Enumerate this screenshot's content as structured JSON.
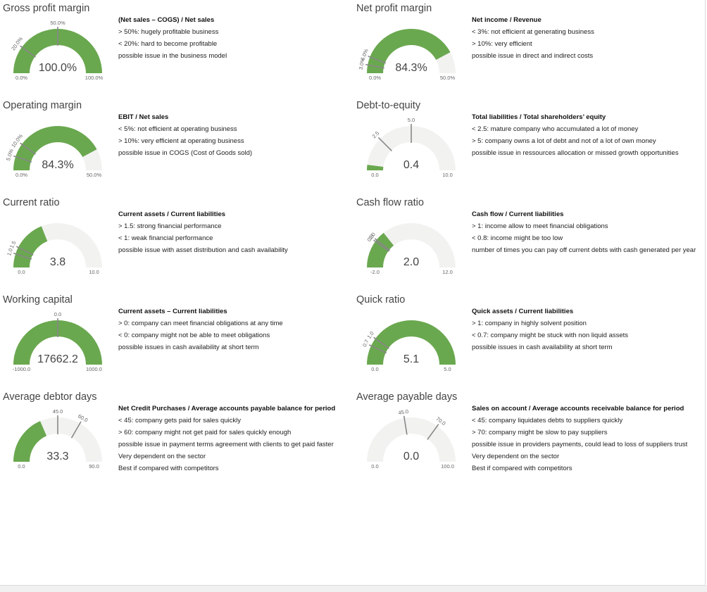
{
  "colors": {
    "track": "#f2f2f0",
    "fill": "#6aa84f",
    "marker": "#888888",
    "text": "#444444"
  },
  "chart_data": [
    {
      "type": "gauge",
      "title": "Gross profit margin",
      "min": 0.0,
      "max": 100.0,
      "value": 100.0,
      "value_label": "100.0%",
      "min_label": "0.0%",
      "max_label": "100.0%",
      "markers": [
        {
          "value": 20.0,
          "label": "20.0%"
        },
        {
          "value": 50.0,
          "label": "50.0%"
        }
      ],
      "formula": "(Net sales – COGS) / Net sales",
      "notes": [
        "> 50%: hugely profitable business",
        "< 20%: hard to become profitable",
        "possible issue in the business model"
      ]
    },
    {
      "type": "gauge",
      "title": "Net profit margin",
      "min": 0.0,
      "max": 50.0,
      "value": 42.15,
      "value_label": "84.3%",
      "min_label": "0.0%",
      "max_label": "50.0%",
      "markers": [
        {
          "value": 3.0,
          "label": "3.0%"
        },
        {
          "value": 6.0,
          "label": "6.0%"
        }
      ],
      "formula": "Net income / Revenue",
      "notes": [
        "< 3%: not efficient at generating business",
        "> 10%: very efficient",
        "possible issue in direct and indirect costs"
      ]
    },
    {
      "type": "gauge",
      "title": "Operating margin",
      "min": 0.0,
      "max": 50.0,
      "value": 42.15,
      "value_label": "84.3%",
      "min_label": "0.0%",
      "max_label": "50.0%",
      "markers": [
        {
          "value": 5.0,
          "label": "5.0%"
        },
        {
          "value": 10.0,
          "label": "10.0%"
        }
      ],
      "formula": "EBIT / Net sales",
      "notes": [
        "< 5%: not efficient at operating business",
        "> 10%: very efficient at operating business",
        "possible issue in COGS (Cost of Goods sold)"
      ]
    },
    {
      "type": "gauge",
      "title": "Debt-to-equity",
      "min": 0.0,
      "max": 10.0,
      "value": 0.4,
      "value_label": "0.4",
      "min_label": "0.0",
      "max_label": "10.0",
      "markers": [
        {
          "value": 2.5,
          "label": "2.5"
        },
        {
          "value": 5.0,
          "label": "5.0"
        }
      ],
      "formula": "Total liabilities / Total shareholders’ equity",
      "notes": [
        "< 2.5: mature company who accumulated a lot of money",
        "> 5: company owns a lot of debt and not of a lot of own money",
        "possible issue in ressources allocation or missed growth opportunities"
      ]
    },
    {
      "type": "gauge",
      "title": "Current ratio",
      "min": 0.0,
      "max": 10.0,
      "value": 3.8,
      "value_label": "3.8",
      "min_label": "0.0",
      "max_label": "10.0",
      "markers": [
        {
          "value": 1.0,
          "label": "1.0"
        },
        {
          "value": 1.5,
          "label": "1.5"
        }
      ],
      "formula": "Current assets / Current liabilities",
      "notes": [
        "> 1.5: strong financial performance",
        "< 1: weak financial performance",
        "possible issue with asset distribution and cash availability"
      ]
    },
    {
      "type": "gauge",
      "title": "Cash flow ratio",
      "min": -2.0,
      "max": 12.0,
      "value": 2.0,
      "value_label": "2.0",
      "min_label": "-2.0",
      "max_label": "12.0",
      "markers": [
        {
          "value": 0.8,
          "label": "0.8"
        },
        {
          "value": 1.0,
          "label": "1.0"
        }
      ],
      "formula": "Cash flow / Current liabilities",
      "notes": [
        "> 1: income allow to meet financial obligations",
        "< 0.8: income might be too low",
        "number of times you can pay off current debts with cash generated per year"
      ]
    },
    {
      "type": "gauge",
      "title": "Working capital",
      "min": -1000.0,
      "max": 1000.0,
      "value": 17662.2,
      "value_label": "17662.2",
      "min_label": "-1000.0",
      "max_label": "1000.0",
      "markers": [
        {
          "value": 0.0,
          "label": "0.0"
        }
      ],
      "formula": "Current assets – Current liabilities",
      "notes": [
        "> 0: company can meet financial obligations at any time",
        "< 0: company might not be able to meet obligations",
        "possible issues in cash availability at short term"
      ]
    },
    {
      "type": "gauge",
      "title": "Quick ratio",
      "min": 0.0,
      "max": 5.0,
      "value": 5.1,
      "value_label": "5.1",
      "min_label": "0.0",
      "max_label": "5.0",
      "markers": [
        {
          "value": 0.7,
          "label": "0.7"
        },
        {
          "value": 1.0,
          "label": "1.0"
        }
      ],
      "formula": "Quick assets / Current liabilities",
      "notes": [
        "> 1: company in highly solvent position",
        "< 0.7: company might be stuck with non liquid assets",
        "possible issues in cash availability at short term"
      ]
    },
    {
      "type": "gauge",
      "title": "Average debtor days",
      "min": 0.0,
      "max": 90.0,
      "value": 33.3,
      "value_label": "33.3",
      "min_label": "0.0",
      "max_label": "90.0",
      "markers": [
        {
          "value": 45.0,
          "label": "45.0"
        },
        {
          "value": 60.0,
          "label": "60.0"
        }
      ],
      "formula": "Net Credit Purchases / Average accounts payable balance for period",
      "notes": [
        "< 45: company gets paid for sales quickly",
        "> 60: company might not get paid for sales quickly enough",
        "possible issue in payment terms agreement with clients to get paid faster",
        "Very dependent on the sector",
        "Best if compared with competitors"
      ]
    },
    {
      "type": "gauge",
      "title": "Average payable days",
      "min": 0.0,
      "max": 100.0,
      "value": 0.0,
      "value_label": "0.0",
      "min_label": "0.0",
      "max_label": "100.0",
      "markers": [
        {
          "value": 45.0,
          "label": "45.0"
        },
        {
          "value": 70.0,
          "label": "70.0"
        }
      ],
      "formula": "Sales on account / Average accounts receivable balance for period",
      "notes": [
        "< 45: company liquidates debts to suppliers quickly",
        "> 70: company might be slow to pay suppliers",
        "possible issue in providers payments, could lead to loss of suppliers trust",
        "Very dependent on the sector",
        "Best if compared with competitors"
      ]
    }
  ]
}
